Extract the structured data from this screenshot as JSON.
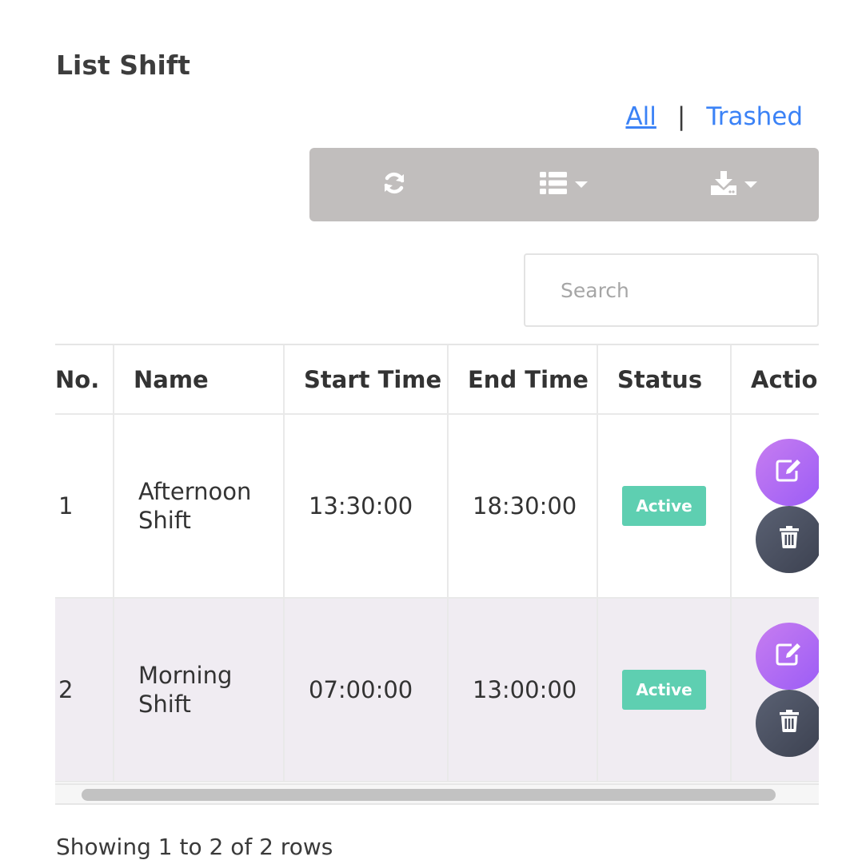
{
  "page": {
    "title": "List Shift"
  },
  "filters": {
    "all_label": "All",
    "separator": "|",
    "trashed_label": "Trashed",
    "active": "All"
  },
  "toolbar": {
    "buttons": [
      "refresh-icon",
      "columns-icon",
      "export-icon"
    ]
  },
  "search": {
    "placeholder": "Search",
    "value": ""
  },
  "table": {
    "headers": {
      "no": "No.",
      "name": "Name",
      "start_time": "Start Time",
      "end_time": "End Time",
      "status": "Status",
      "action": "Actio"
    },
    "rows": [
      {
        "no": "1",
        "name_line1": "Afternoon",
        "name_line2": "Shift",
        "start_time": "13:30:00",
        "end_time": "18:30:00",
        "status": "Active"
      },
      {
        "no": "2",
        "name_line1": "Morning",
        "name_line2": "Shift",
        "start_time": "07:00:00",
        "end_time": "13:00:00",
        "status": "Active"
      }
    ]
  },
  "footer": {
    "info": "Showing 1 to 2 of 2 rows"
  },
  "colors": {
    "link": "#3b82f6",
    "toolbar_bg": "#c1bebd",
    "badge": "#5ecfb1",
    "edit_btn": "#b06cf2",
    "delete_btn": "#4b5060",
    "alt_row": "#f0ecf2"
  }
}
